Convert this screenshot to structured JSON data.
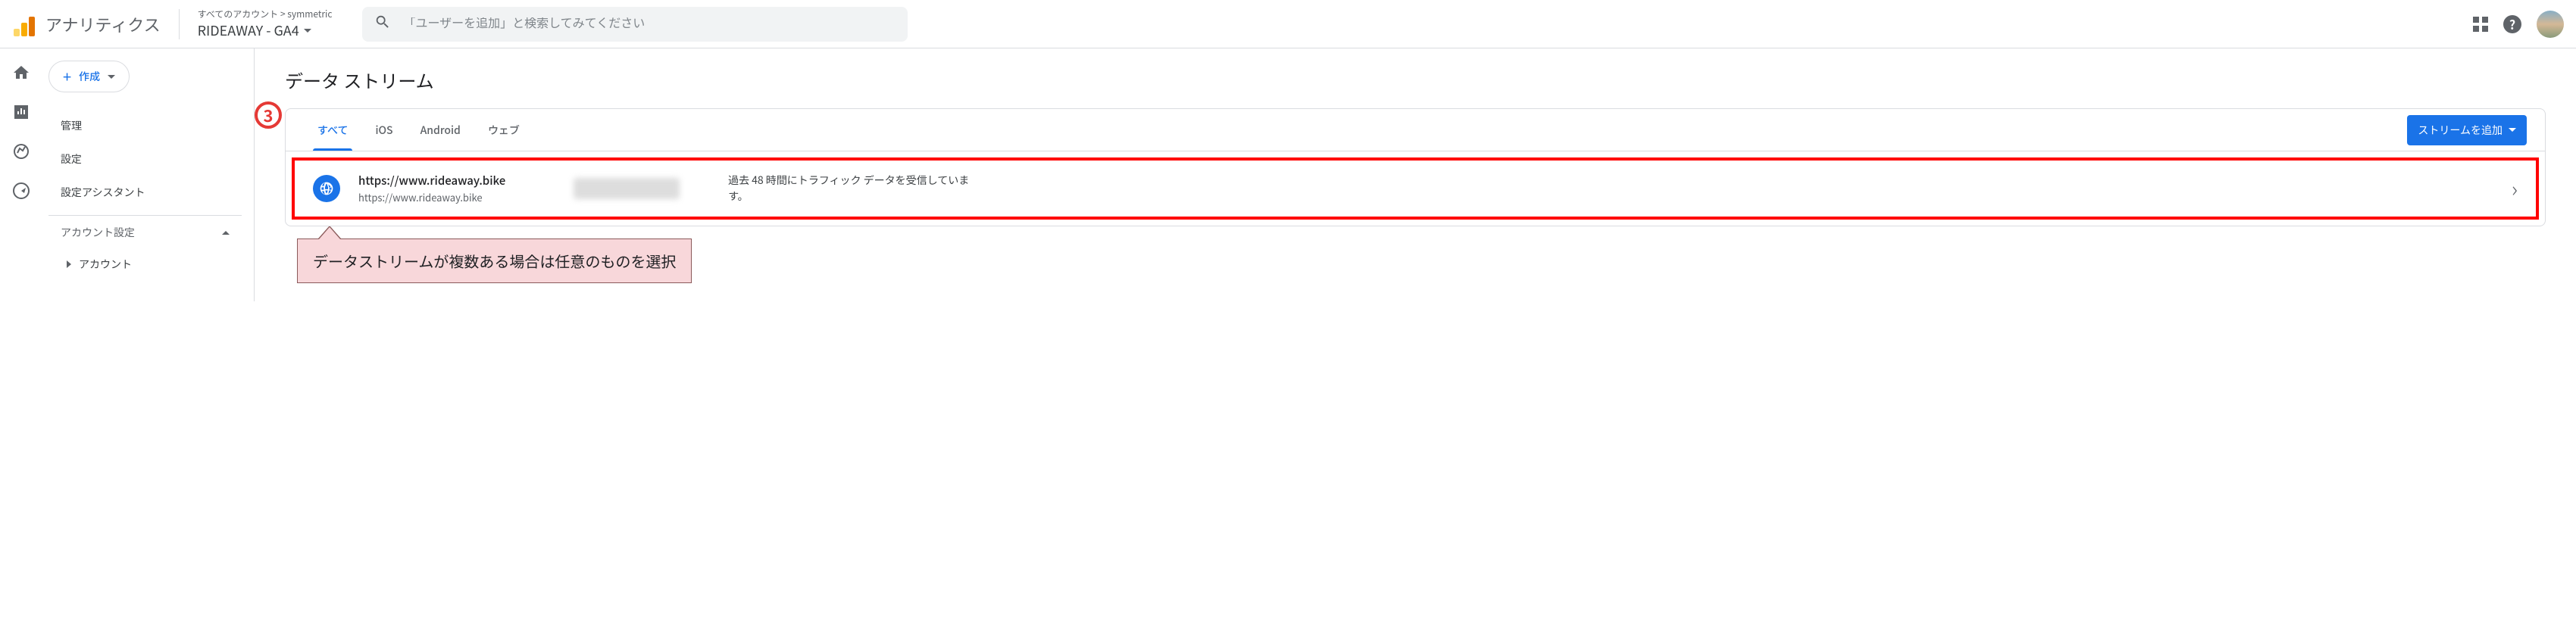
{
  "header": {
    "product_name": "アナリティクス",
    "breadcrumb": "すべてのアカウント > symmetric",
    "property_name": "RIDEAWAY - GA4",
    "search_placeholder": "「ユーザーを追加」と検索してみてください"
  },
  "sidebar": {
    "create_label": "作成",
    "items": [
      "管理",
      "設定",
      "設定アシスタント"
    ],
    "section_label": "アカウント設定",
    "subitems": [
      "アカウント"
    ]
  },
  "main": {
    "page_title": "データ ストリーム",
    "step_number": "3",
    "tabs": [
      "すべて",
      "iOS",
      "Android",
      "ウェブ"
    ],
    "active_tab_index": 0,
    "add_stream_label": "ストリームを追加",
    "stream": {
      "name": "https://www.rideaway.bike",
      "url": "https://www.rideaway.bike",
      "status": "過去 48 時間にトラフィック データを受信しています。"
    },
    "callout_text": "データストリームが複数ある場合は任意のものを選択"
  }
}
